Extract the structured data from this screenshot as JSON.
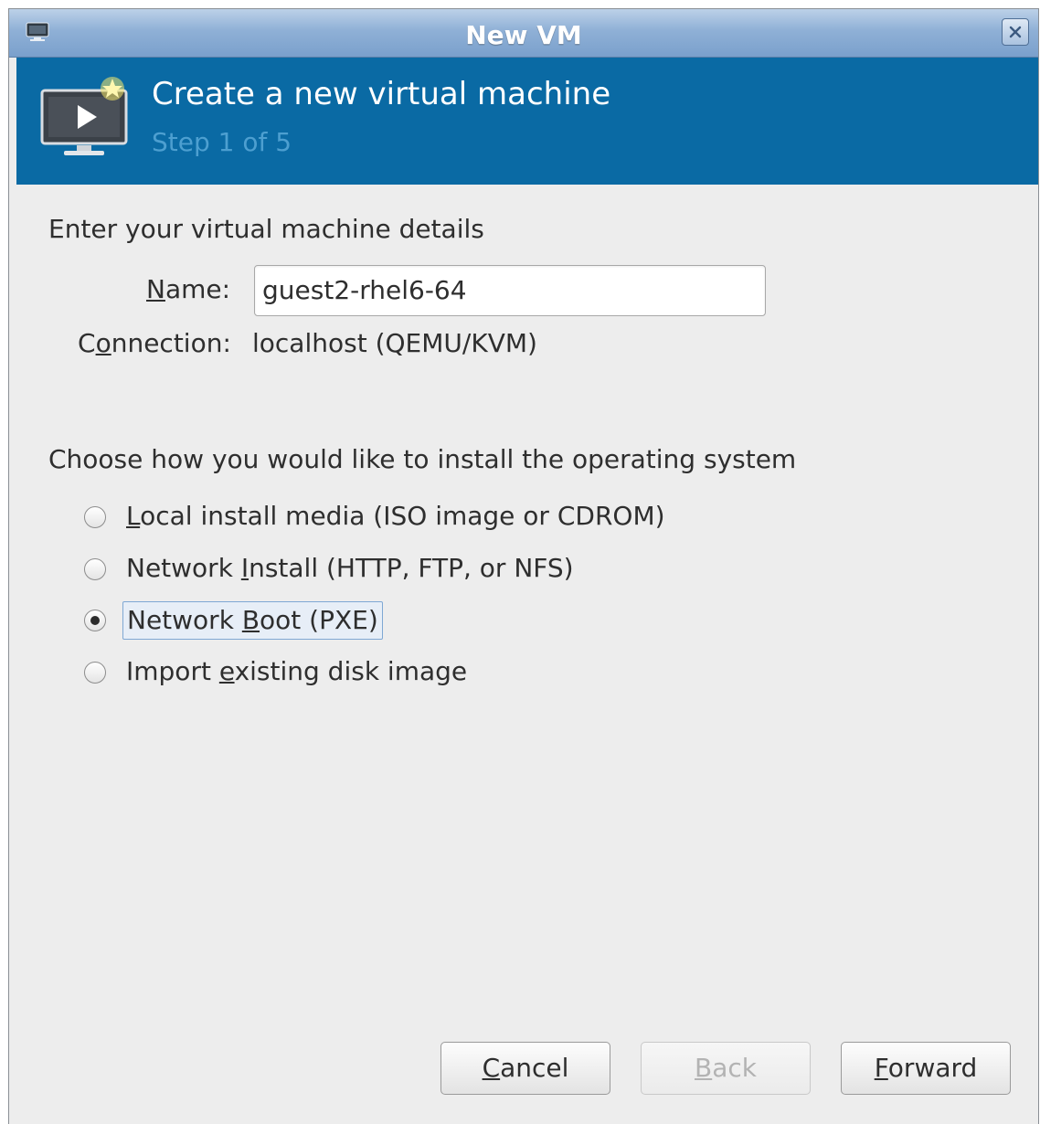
{
  "window": {
    "title": "New VM"
  },
  "banner": {
    "heading": "Create a new virtual machine",
    "step": "Step 1 of 5"
  },
  "details": {
    "section_label": "Enter your virtual machine details",
    "name_label": "Name:",
    "name_value": "guest2-rhel6-64",
    "connection_label": "Connection:",
    "connection_value": "localhost (QEMU/KVM)"
  },
  "install": {
    "section_label": "Choose how you would like to install the operating system",
    "options": [
      {
        "pre": "",
        "mnemonic": "L",
        "post": "ocal install media (ISO image or CDROM)",
        "checked": false
      },
      {
        "pre": "Network ",
        "mnemonic": "I",
        "post": "nstall (HTTP, FTP, or NFS)",
        "checked": false
      },
      {
        "pre": "Network ",
        "mnemonic": "B",
        "post": "oot (PXE)",
        "checked": true
      },
      {
        "pre": "Import ",
        "mnemonic": "e",
        "post": "xisting disk image",
        "checked": false
      }
    ]
  },
  "buttons": {
    "cancel_mnemonic": "C",
    "cancel_rest": "ancel",
    "back_mnemonic": "B",
    "back_rest": "ack",
    "forward_mnemonic": "F",
    "forward_rest": "orward"
  },
  "colors": {
    "banner": "#0a6aa4",
    "step_text": "#4d9fd0",
    "titlebar": "#8fb0d6"
  },
  "icons": {
    "titlebar": "computer-icon",
    "close": "close-icon",
    "banner": "new-vm-monitor-icon"
  }
}
